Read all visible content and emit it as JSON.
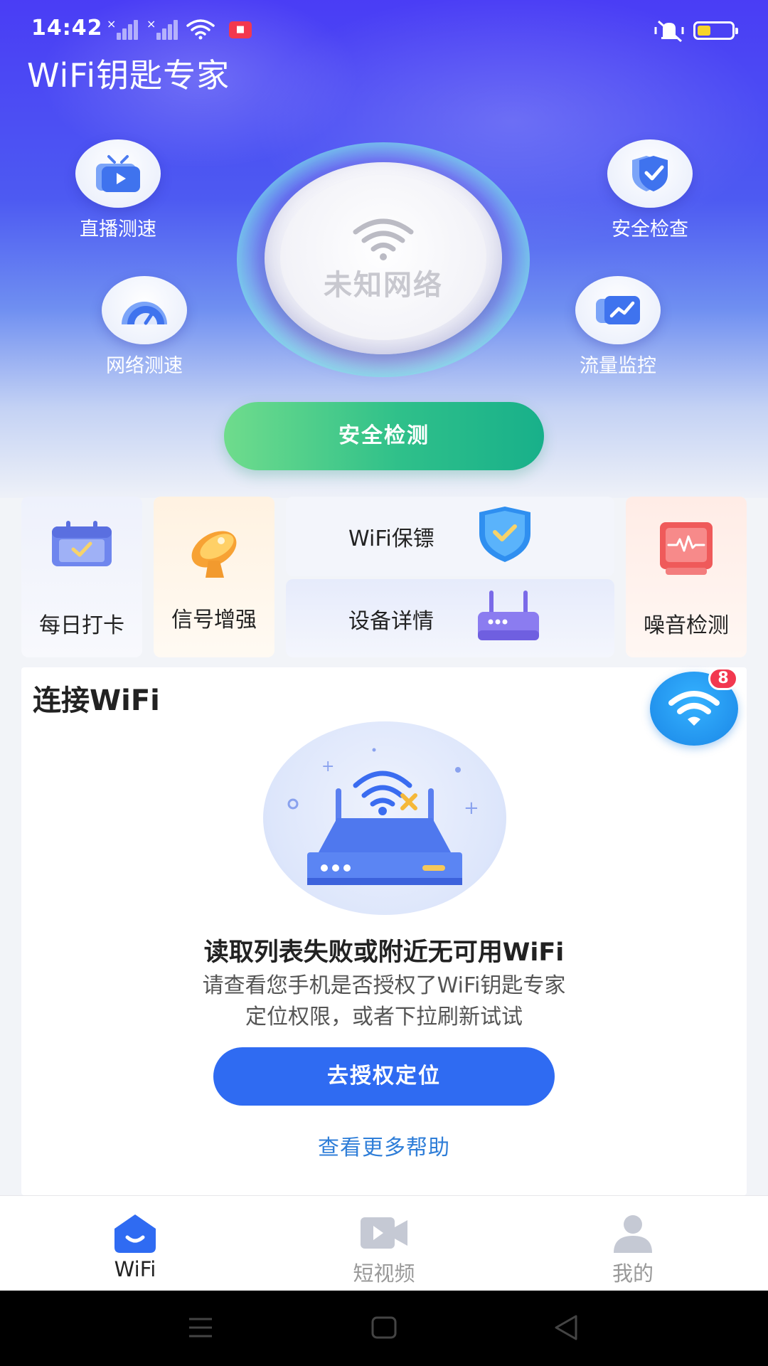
{
  "status_bar": {
    "time": "14:42",
    "record_label": "■"
  },
  "app": {
    "title": "WiFi钥匙专家"
  },
  "features": {
    "live_speed": "直播测速",
    "net_speed": "网络测速",
    "security_check": "安全检查",
    "traffic_monitor": "流量监控"
  },
  "network": {
    "status": "未知网络",
    "scan_button": "安全检测"
  },
  "tools": {
    "daily_checkin": "每日打卡",
    "signal_boost": "信号增强",
    "wifi_guard": "WiFi保镖",
    "device_detail": "设备详情",
    "noise_detect": "噪音检测"
  },
  "connect": {
    "title": "连接WiFi",
    "badge_count": "8",
    "error_title": "读取列表失败或附近无可用WiFi",
    "error_desc_line1": "请查看您手机是否授权了WiFi钥匙专家",
    "error_desc_line2": "定位权限，或者下拉刷新试试",
    "auth_button": "去授权定位",
    "help_link": "查看更多帮助"
  },
  "tabs": [
    {
      "label": "WiFi",
      "active": true
    },
    {
      "label": "短视频",
      "active": false
    },
    {
      "label": "我的",
      "active": false
    }
  ],
  "colors": {
    "accent": "#2f6bf2",
    "scan_green": "#2fc08a",
    "badge_red": "#f2384f",
    "link_blue": "#2f7ed8"
  },
  "icons": {
    "live_speed": "tv-play-icon",
    "net_speed": "speedometer-icon",
    "security_check": "shield-check-icon",
    "traffic_monitor": "chart-line-icon",
    "daily_checkin": "calendar-check-icon",
    "signal_boost": "satellite-dish-icon",
    "wifi_guard": "shield-check-icon",
    "device_detail": "router-icon",
    "noise_detect": "sound-wave-icon"
  }
}
